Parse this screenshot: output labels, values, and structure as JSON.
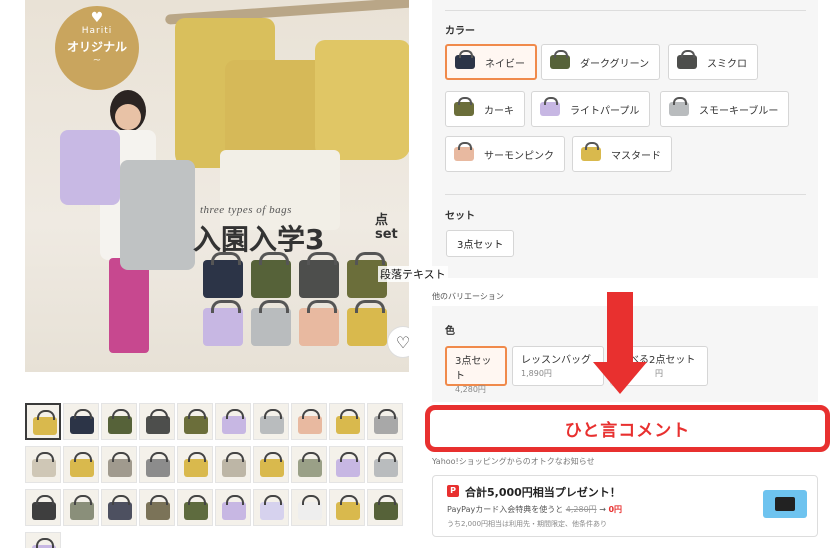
{
  "hero": {
    "badge_brand": "Hariti",
    "badge_label": "オリジナル",
    "tagline": "three types of bags",
    "headline": "入園入学3",
    "headline_suffix": "点 set",
    "minibag_colors": [
      "#2c3447",
      "#566239",
      "#4d4e4c",
      "#6b6e3a",
      "#c7b7e3",
      "#b9bcbe",
      "#e8b9a0",
      "#d9b94d"
    ]
  },
  "thumbnails": {
    "colors": [
      "#d9b94d",
      "#2c3447",
      "#566239",
      "#4d4e4c",
      "#6b6e3a",
      "#c7b7e3",
      "#b9bcbe",
      "#e8b9a0",
      "#d9b94d",
      "#a8a8a8",
      "#cfc7b6",
      "#d9b94d",
      "#a09a8e",
      "#8c8c8c",
      "#d9b94d",
      "#bdb6a6",
      "#d9b94d",
      "#9aa087",
      "#c7b7e3",
      "#b9bcbe",
      "#3e3e3e",
      "#8a8f7a",
      "#4d5060",
      "#7b7358",
      "#5e6b3e",
      "#c7b7e3",
      "#d6d2ee",
      "#eeeeee",
      "#d9b94d",
      "#566239",
      "#c7b7e3"
    ]
  },
  "color_section": {
    "label": "カラー",
    "options": [
      {
        "label": "ネイビー",
        "color": "#2c3447"
      },
      {
        "label": "ダークグリーン",
        "color": "#566239"
      },
      {
        "label": "スミクロ",
        "color": "#4d4e4c"
      },
      {
        "label": "カーキ",
        "color": "#6b6e3a"
      },
      {
        "label": "ライトパープル",
        "color": "#c7b7e3"
      },
      {
        "label": "スモーキーブルー",
        "color": "#b9bcbe"
      },
      {
        "label": "サーモンピンク",
        "color": "#e8b9a0"
      },
      {
        "label": "マスタード",
        "color": "#d9b94d"
      }
    ]
  },
  "set_section": {
    "label": "セット",
    "option": "3点セット"
  },
  "overlay_text": "段落テキスト",
  "other_variations": "他のバリエーション",
  "variation_section": {
    "label": "色",
    "options": [
      {
        "name": "3点セット",
        "price": "4,280円"
      },
      {
        "name": "レッスンバッグ",
        "price": "1,890円"
      },
      {
        "name": "べる2点セット",
        "price": "円"
      }
    ]
  },
  "comment_box": "ひと言コメント",
  "notice_title": "Yahoo!ショッピングからのオトクなお知らせ",
  "promo": {
    "icon": "P",
    "title": "合計5,000円相当プレゼント！",
    "sub_prefix": "PayPayカード入会特典を使うと",
    "old_price": "4,280円",
    "arrow": "→",
    "new_price": "0円",
    "note": "うち2,000円相当は利用先・期間限定、他条件あり"
  },
  "accent_color": "#e8302f",
  "selected_color": "#f08a4b"
}
